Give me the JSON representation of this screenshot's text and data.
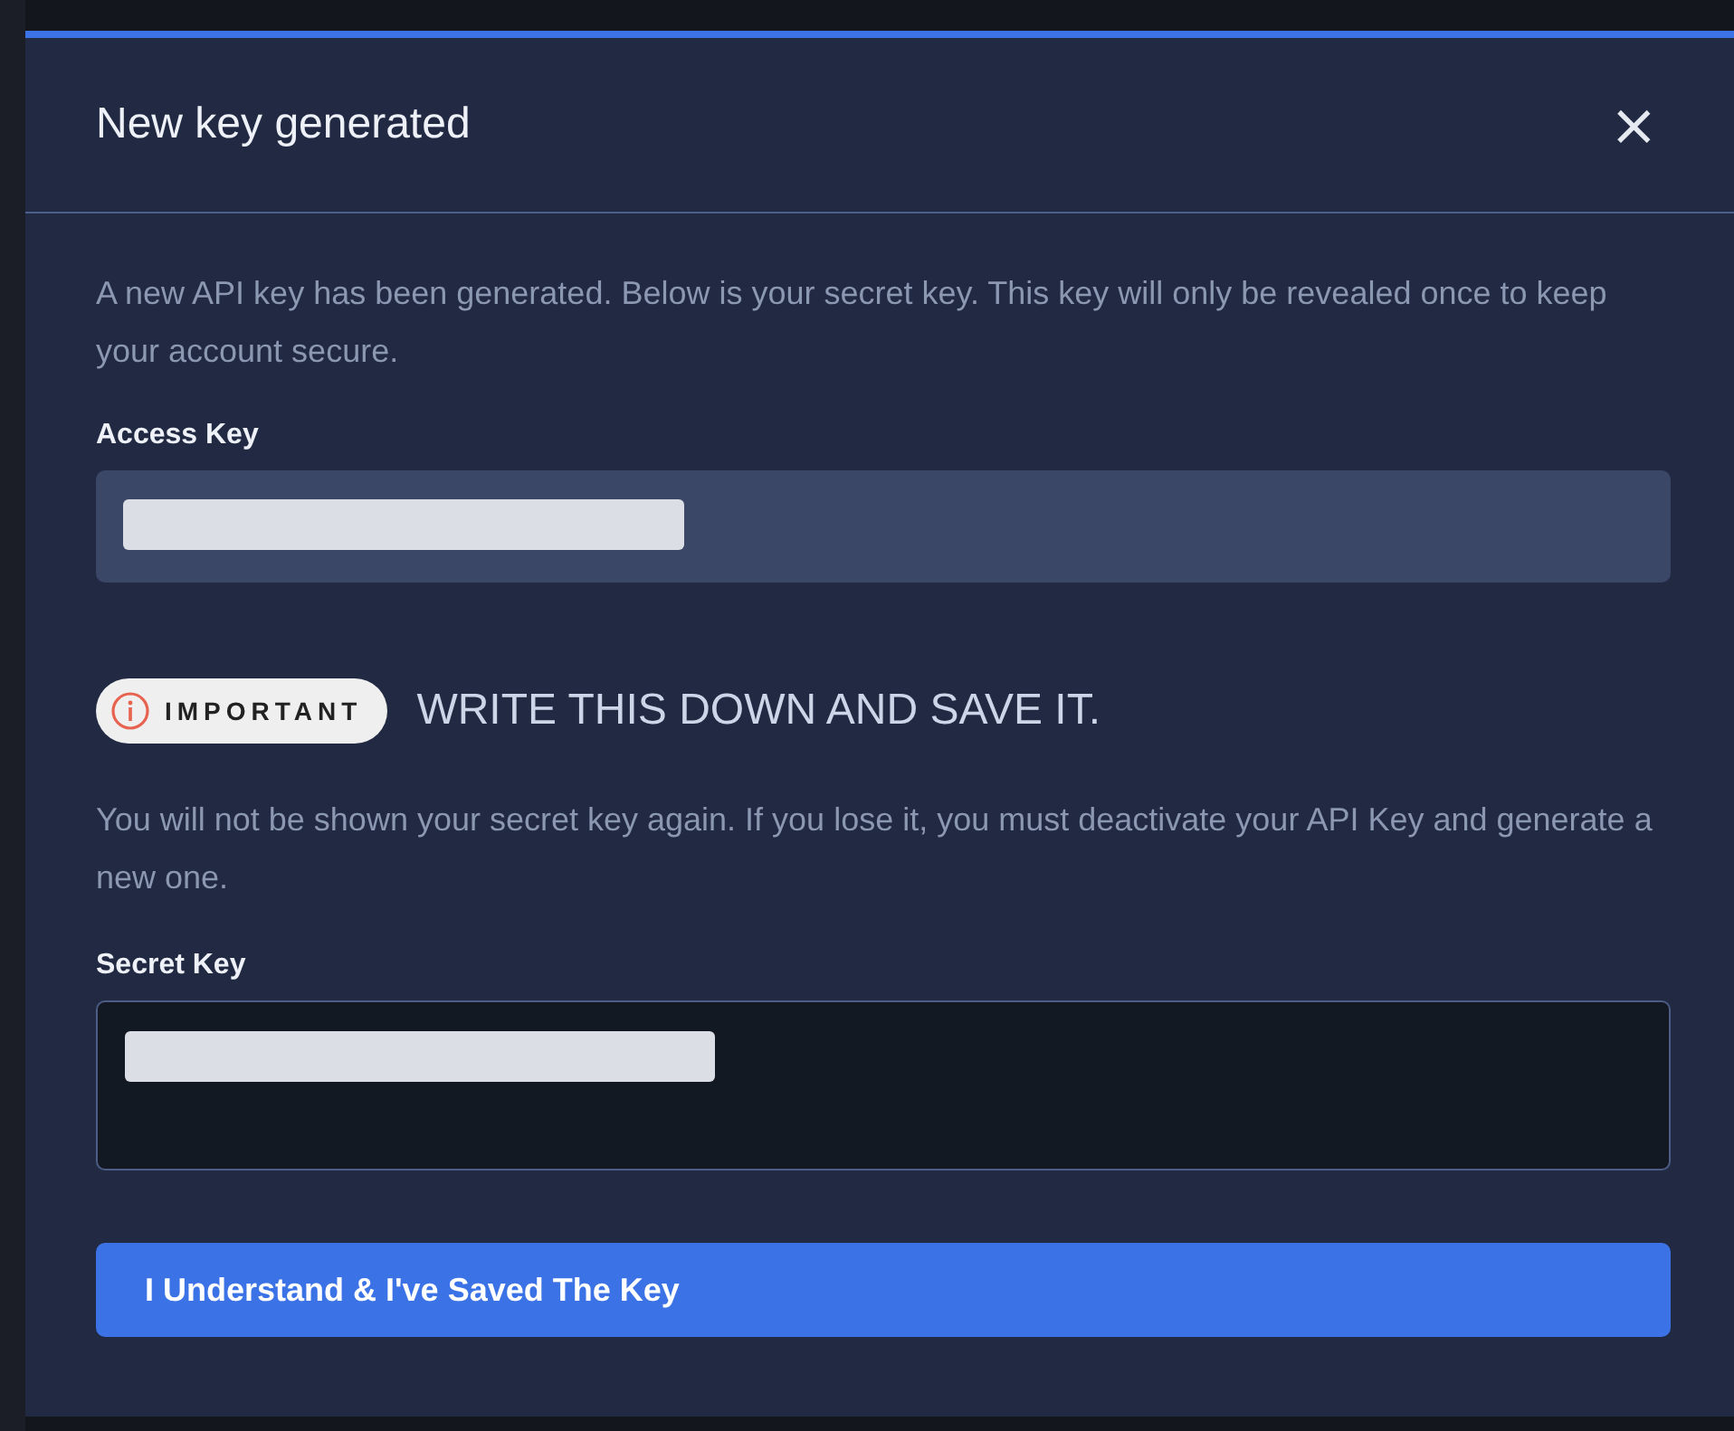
{
  "dialog": {
    "title": "New key generated",
    "close": "×"
  },
  "intro": "A new API key has been generated. Below is your secret key. This key will only be revealed once to keep your account secure.",
  "access_key": {
    "label": "Access Key",
    "redacted": true
  },
  "notice": {
    "badge": "IMPORTANT",
    "heading": "WRITE THIS DOWN AND SAVE IT."
  },
  "warning": "You will not be shown your secret key again. If you lose it, you must deactivate your API Key and generate a new one.",
  "secret_key": {
    "label": "Secret Key",
    "redacted": true
  },
  "confirm_button": "I Understand & I've Saved The Key"
}
